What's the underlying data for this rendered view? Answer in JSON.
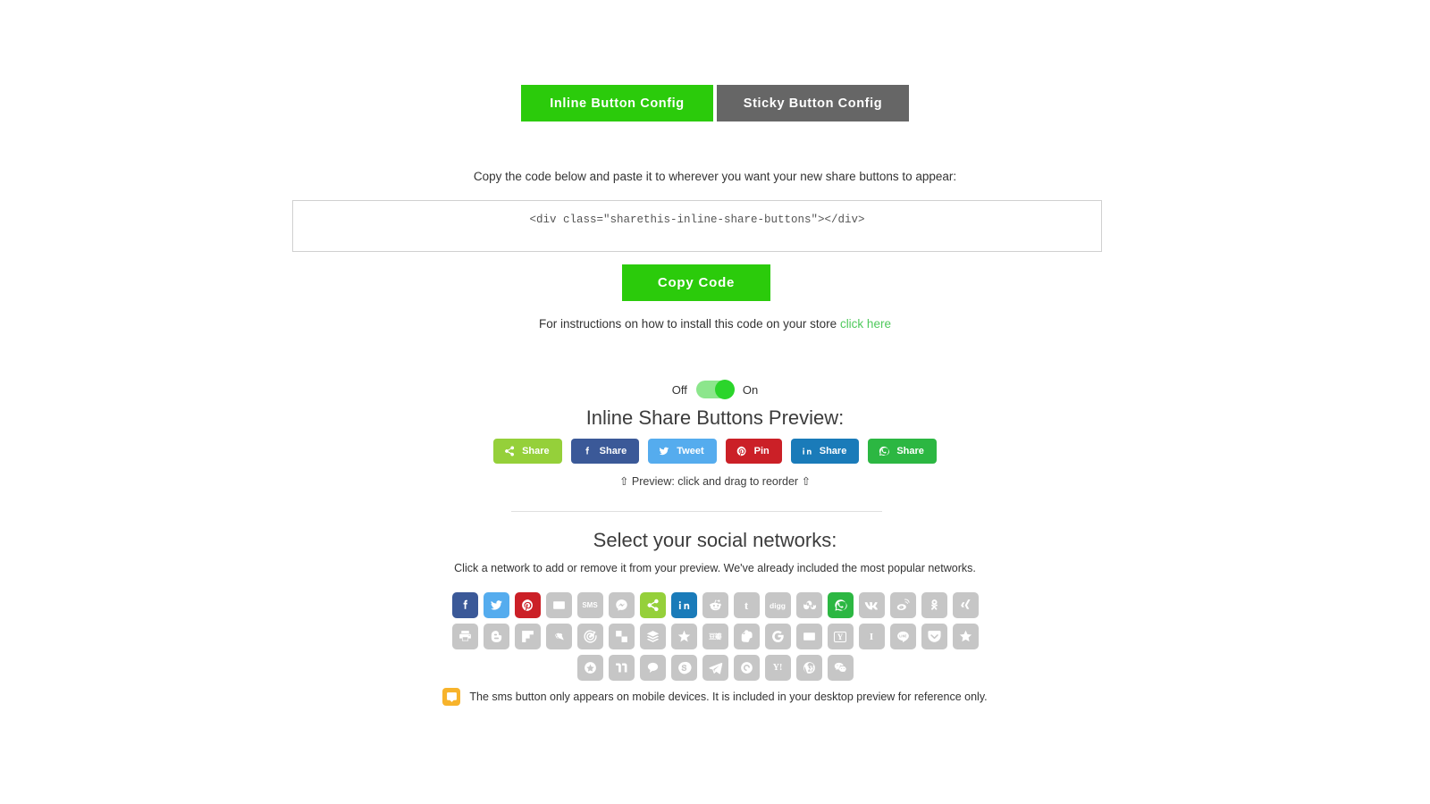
{
  "tabs": [
    {
      "label": "Inline Button Config",
      "state": "active",
      "color": "#2bcb0b"
    },
    {
      "label": "Sticky Button Config",
      "state": "inactive",
      "color": "#666666"
    }
  ],
  "copy_section": {
    "hint": "Copy the code below and paste it to wherever you want your new share buttons to appear:",
    "code_value": "<div class=\"sharethis-inline-share-buttons\"></div>",
    "code_placeholder": "",
    "button_label": "Copy Code",
    "instructions_text": "For instructions on how to install this code on your store ",
    "instructions_link": "click here",
    "link_color": "#4fc95c"
  },
  "toggle": {
    "off_label": "Off",
    "on_label": "On",
    "state": "on",
    "track_color": "#8ce68c",
    "knob_color": "#2bd52b"
  },
  "preview": {
    "title": "Inline Share Buttons Preview:",
    "hint": "⇧ Preview: click and drag to reorder ⇧",
    "buttons": [
      {
        "network": "sharethis",
        "label": "Share",
        "color": "#95d03a",
        "icon": "sharethis-icon"
      },
      {
        "network": "facebook",
        "label": "Share",
        "color": "#3b5998",
        "icon": "facebook-icon"
      },
      {
        "network": "twitter",
        "label": "Tweet",
        "color": "#55acee",
        "icon": "twitter-icon"
      },
      {
        "network": "pinterest",
        "label": "Pin",
        "color": "#cb2027",
        "icon": "pinterest-icon"
      },
      {
        "network": "linkedin",
        "label": "Share",
        "color": "#1a7bb9",
        "icon": "linkedin-icon"
      },
      {
        "network": "whatsapp",
        "label": "Share",
        "color": "#2cb742",
        "icon": "whatsapp-icon"
      }
    ]
  },
  "networks_section": {
    "title": "Select your social networks:",
    "subtitle": "Click a network to add or remove it from your preview. We've already included the most popular networks.",
    "active_color_default": "#c6c6c6",
    "rows": [
      [
        {
          "name": "facebook",
          "icon": "facebook-icon",
          "selected": true,
          "color": "#3b5998"
        },
        {
          "name": "twitter",
          "icon": "twitter-icon",
          "selected": true,
          "color": "#55acee"
        },
        {
          "name": "pinterest",
          "icon": "pinterest-icon",
          "selected": true,
          "color": "#cb2027"
        },
        {
          "name": "email",
          "icon": "email-icon",
          "selected": false,
          "color": "#c6c6c6"
        },
        {
          "name": "sms",
          "icon": "sms-icon",
          "selected": false,
          "color": "#c6c6c6"
        },
        {
          "name": "messenger",
          "icon": "messenger-icon",
          "selected": false,
          "color": "#c6c6c6"
        },
        {
          "name": "sharethis",
          "icon": "sharethis-icon",
          "selected": true,
          "color": "#95d03a"
        },
        {
          "name": "linkedin",
          "icon": "linkedin-icon",
          "selected": true,
          "color": "#1a7bb9"
        },
        {
          "name": "reddit",
          "icon": "reddit-icon",
          "selected": false,
          "color": "#c6c6c6"
        },
        {
          "name": "tumblr",
          "icon": "tumblr-icon",
          "selected": false,
          "color": "#c6c6c6"
        },
        {
          "name": "digg",
          "icon": "digg-icon",
          "selected": false,
          "color": "#c6c6c6"
        },
        {
          "name": "stumbleupon",
          "icon": "stumbleupon-icon",
          "selected": false,
          "color": "#c6c6c6"
        },
        {
          "name": "whatsapp",
          "icon": "whatsapp-icon",
          "selected": true,
          "color": "#2cb742"
        },
        {
          "name": "vk",
          "icon": "vk-icon",
          "selected": false,
          "color": "#c6c6c6"
        },
        {
          "name": "weibo",
          "icon": "weibo-icon",
          "selected": false,
          "color": "#c6c6c6"
        },
        {
          "name": "odnoklassniki",
          "icon": "odnoklassniki-icon",
          "selected": false,
          "color": "#c6c6c6"
        },
        {
          "name": "xing",
          "icon": "xing-icon",
          "selected": false,
          "color": "#c6c6c6"
        }
      ],
      [
        {
          "name": "print",
          "icon": "print-icon",
          "selected": false,
          "color": "#c6c6c6"
        },
        {
          "name": "blogger",
          "icon": "blogger-icon",
          "selected": false,
          "color": "#c6c6c6"
        },
        {
          "name": "flipboard",
          "icon": "flipboard-icon",
          "selected": false,
          "color": "#c6c6c6"
        },
        {
          "name": "livejournal",
          "icon": "livejournal-icon",
          "selected": false,
          "color": "#c6c6c6"
        },
        {
          "name": "diigo",
          "icon": "diigo-icon",
          "selected": false,
          "color": "#c6c6c6"
        },
        {
          "name": "delicious",
          "icon": "delicious-icon",
          "selected": false,
          "color": "#c6c6c6"
        },
        {
          "name": "buffer",
          "icon": "buffer-icon",
          "selected": false,
          "color": "#c6c6c6"
        },
        {
          "name": "aol",
          "icon": "aol-icon",
          "selected": false,
          "color": "#c6c6c6"
        },
        {
          "name": "douban",
          "icon": "douban-icon",
          "selected": false,
          "color": "#c6c6c6"
        },
        {
          "name": "evernote",
          "icon": "evernote-icon",
          "selected": false,
          "color": "#c6c6c6"
        },
        {
          "name": "google",
          "icon": "google-icon",
          "selected": false,
          "color": "#c6c6c6"
        },
        {
          "name": "mailru",
          "icon": "mailru-icon",
          "selected": false,
          "color": "#c6c6c6"
        },
        {
          "name": "yummly",
          "icon": "yummly-icon",
          "selected": false,
          "color": "#c6c6c6"
        },
        {
          "name": "instapaper",
          "icon": "instapaper-icon",
          "selected": false,
          "color": "#c6c6c6"
        },
        {
          "name": "line",
          "icon": "line-icon",
          "selected": false,
          "color": "#c6c6c6"
        },
        {
          "name": "pocket",
          "icon": "pocket-icon",
          "selected": false,
          "color": "#c6c6c6"
        },
        {
          "name": "favorites",
          "icon": "star-icon",
          "selected": false,
          "color": "#c6c6c6"
        }
      ],
      [
        {
          "name": "qzone",
          "icon": "qzone-icon",
          "selected": false,
          "color": "#c6c6c6"
        },
        {
          "name": "mix",
          "icon": "mix-icon",
          "selected": false,
          "color": "#c6c6c6"
        },
        {
          "name": "kakao",
          "icon": "kakao-icon",
          "selected": false,
          "color": "#c6c6c6"
        },
        {
          "name": "skype",
          "icon": "skype-icon",
          "selected": false,
          "color": "#c6c6c6"
        },
        {
          "name": "telegram",
          "icon": "telegram-icon",
          "selected": false,
          "color": "#c6c6c6"
        },
        {
          "name": "refind",
          "icon": "refind-icon",
          "selected": false,
          "color": "#c6c6c6"
        },
        {
          "name": "yahoo",
          "icon": "yahoo-icon",
          "selected": false,
          "color": "#c6c6c6"
        },
        {
          "name": "wordpress",
          "icon": "wordpress-icon",
          "selected": false,
          "color": "#c6c6c6"
        },
        {
          "name": "wechat",
          "icon": "wechat-icon",
          "selected": false,
          "color": "#c6c6c6"
        }
      ]
    ]
  },
  "footnote": {
    "badge_icon": "sms-icon",
    "badge_color": "#f7b32b",
    "text": "The sms button only appears on mobile devices. It is included in your desktop preview for reference only."
  }
}
